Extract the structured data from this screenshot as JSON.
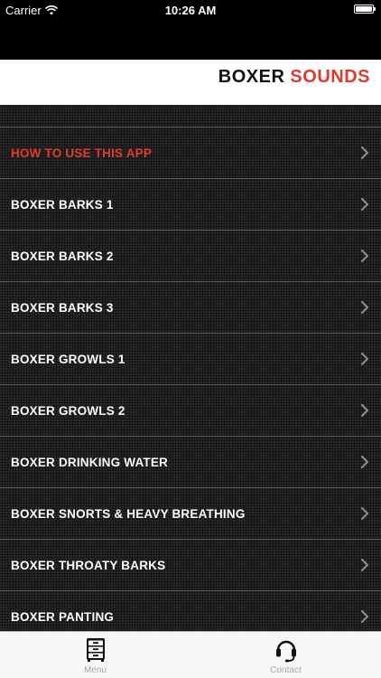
{
  "status_bar": {
    "carrier": "Carrier",
    "time": "10:26 AM"
  },
  "header": {
    "title_part1": "BOXER",
    "title_part2": "SOUNDS",
    "accent_color": "#e03a2f"
  },
  "list": {
    "items": [
      {
        "label": "HOW TO USE THIS APP",
        "highlight": true
      },
      {
        "label": "BOXER BARKS 1"
      },
      {
        "label": "BOXER BARKS 2"
      },
      {
        "label": "BOXER BARKS 3"
      },
      {
        "label": "BOXER GROWLS 1"
      },
      {
        "label": "BOXER GROWLS 2"
      },
      {
        "label": "BOXER DRINKING WATER"
      },
      {
        "label": "BOXER SNORTS & HEAVY BREATHING"
      },
      {
        "label": "BOXER THROATY BARKS"
      },
      {
        "label": "BOXER PANTING"
      }
    ]
  },
  "tab_bar": {
    "tabs": [
      {
        "label": "Menu",
        "icon": "filing-cabinet-icon"
      },
      {
        "label": "Contact",
        "icon": "headset-icon"
      }
    ]
  }
}
